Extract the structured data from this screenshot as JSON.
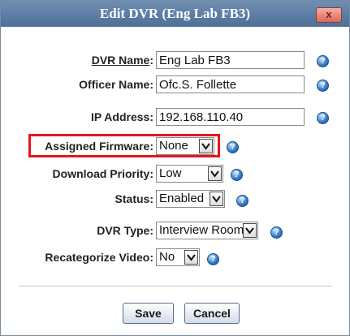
{
  "dialog": {
    "title": "Edit DVR (Eng Lab FB3)",
    "close_glyph": "x"
  },
  "fields": {
    "dvr_name": {
      "label": "DVR Name",
      "value": "Eng Lab FB3"
    },
    "officer_name": {
      "label": "Officer Name",
      "value": "Ofc.S. Follette"
    },
    "ip_address": {
      "label": "IP Address",
      "value": "192.168.110.40"
    },
    "assigned_firmware": {
      "label": "Assigned Firmware",
      "value": "None"
    },
    "download_priority": {
      "label": "Download Priority",
      "value": "Low"
    },
    "status": {
      "label": "Status",
      "value": "Enabled"
    },
    "dvr_type": {
      "label": "DVR Type",
      "value": "Interview Room"
    },
    "recategorize_video": {
      "label": "Recategorize Video",
      "value": "No"
    }
  },
  "buttons": {
    "save": "Save",
    "cancel": "Cancel"
  },
  "colors": {
    "titlebar": "#5a7ba3",
    "highlight": "#e8141c",
    "help_icon": "#2f78c6"
  }
}
